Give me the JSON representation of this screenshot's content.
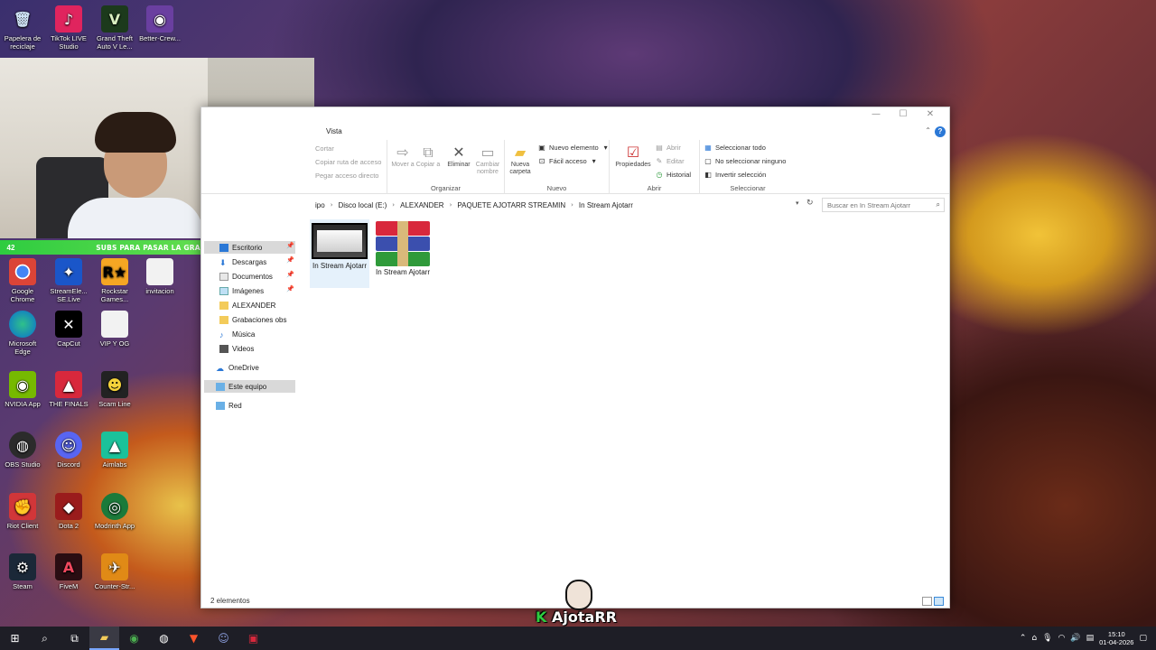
{
  "desktop": {
    "top_icons": [
      {
        "label": "Papelera de reciclaje",
        "icon": "recycle-bin-icon"
      },
      {
        "label": "TikTok LIVE Studio",
        "icon": "tiktok-icon"
      },
      {
        "label": "Grand Theft Auto V Le...",
        "icon": "gta-icon"
      },
      {
        "label": "Better-Crew...",
        "icon": "better-crewlink-icon"
      }
    ],
    "icons": [
      {
        "label": "Google Chrome"
      },
      {
        "label": "StreamEle... SE.Live"
      },
      {
        "label": "Rockstar Games..."
      },
      {
        "label": "invitacion"
      },
      {
        "label": "Microsoft Edge"
      },
      {
        "label": "CapCut"
      },
      {
        "label": "VIP Y OG"
      },
      {
        "label": "NVIDIA App"
      },
      {
        "label": "THE FINALS"
      },
      {
        "label": "Scam Line"
      },
      {
        "label": "OBS Studio"
      },
      {
        "label": "Discord"
      },
      {
        "label": "Aimlabs"
      },
      {
        "label": "Riot Client"
      },
      {
        "label": "Dota 2"
      },
      {
        "label": "Modrinth App"
      },
      {
        "label": "Steam"
      },
      {
        "label": "FiveM"
      },
      {
        "label": "Counter-Str..."
      }
    ]
  },
  "overlay": {
    "subs_left": "42",
    "subs_text": "SUBS PARA PASAR LA GRAFICA",
    "subs_right": "65",
    "logo_text": "AjotaRR",
    "logo_k": "K"
  },
  "explorer": {
    "tab": "Vista",
    "ribbon": {
      "clipboard": {
        "cut": "Cortar",
        "copy_path": "Copiar ruta de acceso",
        "paste_shortcut": "Pegar acceso directo"
      },
      "organize": {
        "move": "Mover a",
        "copy": "Copiar a",
        "delete": "Eliminar",
        "rename": "Cambiar nombre",
        "caption": "Organizar"
      },
      "new": {
        "new_folder": "Nueva carpeta",
        "new_item": "Nuevo elemento",
        "easy_access": "Fácil acceso",
        "caption": "Nuevo"
      },
      "open": {
        "properties": "Propiedades",
        "open": "Abrir",
        "edit": "Editar",
        "history": "Historial",
        "caption": "Abrir"
      },
      "select": {
        "select_all": "Seleccionar todo",
        "select_none": "No seleccionar ninguno",
        "invert": "Invertir selección",
        "caption": "Seleccionar"
      }
    },
    "address": {
      "segments": [
        "ipo",
        "Disco local (E:)",
        "ALEXANDER",
        "PAQUETE AJOTARR STREAMIN",
        "In Stream Ajotarr"
      ],
      "search_placeholder": "Buscar en In Stream Ajotarr"
    },
    "nav": [
      {
        "label": "Escritorio",
        "pinned": true
      },
      {
        "label": "Descargas",
        "pinned": true
      },
      {
        "label": "Documentos",
        "pinned": true
      },
      {
        "label": "Imágenes",
        "pinned": true
      },
      {
        "label": "ALEXANDER",
        "pinned": false
      },
      {
        "label": "Grabaciones obs",
        "pinned": false
      },
      {
        "label": "Música",
        "pinned": false
      },
      {
        "label": "Videos",
        "pinned": false
      },
      {
        "label": "OneDrive",
        "pinned": false
      },
      {
        "label": "Este equipo",
        "pinned": false
      },
      {
        "label": "Red",
        "pinned": false
      }
    ],
    "files": [
      {
        "name": "In Stream Ajotarr",
        "type": "video"
      },
      {
        "name": "In Stream Ajotarr",
        "type": "rar"
      }
    ],
    "status": "2 elementos"
  },
  "taskbar": {
    "time": "15:10",
    "date": "01-04-2026"
  }
}
